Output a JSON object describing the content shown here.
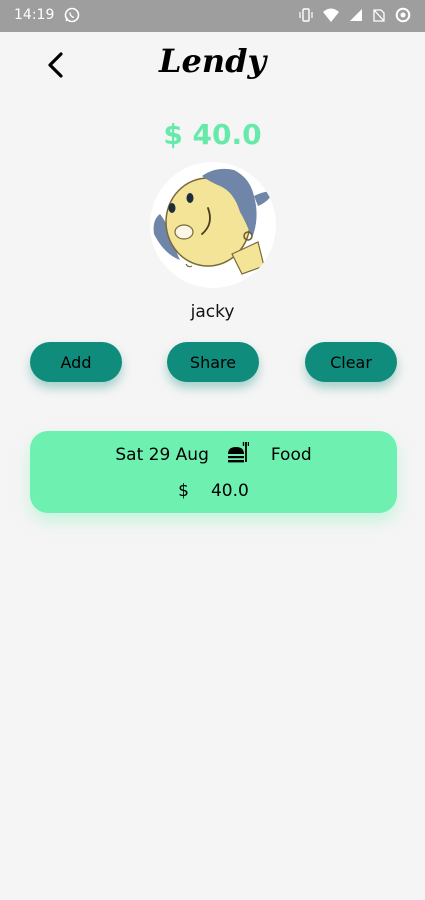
{
  "status_bar": {
    "time": "14:19"
  },
  "app": {
    "title": "Lendy"
  },
  "summary": {
    "total_amount": "$ 40.0"
  },
  "user": {
    "name": "jacky"
  },
  "actions": {
    "add": "Add",
    "share": "Share",
    "clear": "Clear"
  },
  "transactions": [
    {
      "date": "Sat 29 Aug",
      "category": "Food",
      "category_icon": "food-icon",
      "currency": "$",
      "amount": "40.0"
    }
  ],
  "colors": {
    "accent_green": "#66eaaa",
    "button_teal": "#0f8c7c",
    "card_green": "#6ef0b0",
    "background": "#f5f5f5"
  }
}
